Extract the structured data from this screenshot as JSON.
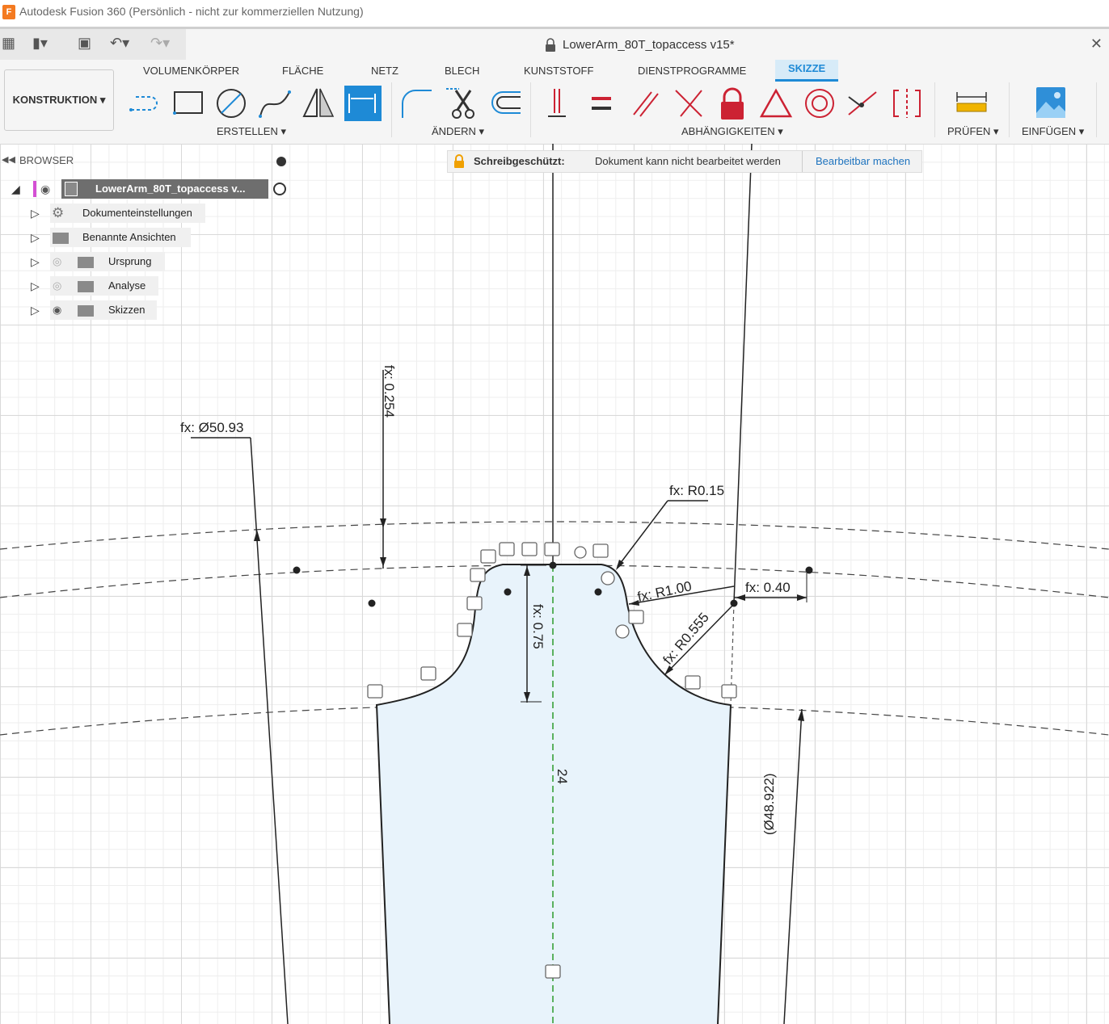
{
  "window": {
    "title": "Autodesk Fusion 360 (Persönlich - nicht zur kommerziellen Nutzung)",
    "app_icon": "F"
  },
  "document": {
    "title": "LowerArm_80T_topaccess v15*"
  },
  "workspace": {
    "label": "KONSTRUKTION ▾"
  },
  "ribbon_tabs": [
    "VOLUMENKÖRPER",
    "FLÄCHE",
    "NETZ",
    "BLECH",
    "KUNSTSTOFF",
    "DIENSTPROGRAMME",
    "SKIZZE"
  ],
  "ribbon_groups": {
    "create": "ERSTELLEN ▾",
    "modify": "ÄNDERN ▾",
    "constraints": "ABHÄNGIGKEITEN ▾",
    "inspect": "PRÜFEN ▾",
    "insert": "EINFÜGEN ▾"
  },
  "browser": {
    "header": "BROWSER",
    "root": "LowerArm_80T_topaccess v...",
    "items": [
      {
        "label": "Dokumenteinstellungen",
        "icon": "gear-icon"
      },
      {
        "label": "Benannte Ansichten",
        "icon": "folder-icon"
      },
      {
        "label": "Ursprung",
        "icon": "folder-icon",
        "visibility": "hidden"
      },
      {
        "label": "Analyse",
        "icon": "folder-icon",
        "visibility": "hidden"
      },
      {
        "label": "Skizzen",
        "icon": "folder-icon",
        "visibility": "visible"
      }
    ]
  },
  "banner": {
    "label": "Schreibgeschützt:",
    "message": "Dokument kann nicht bearbeitet werden",
    "action": "Bearbeitbar machen"
  },
  "dimensions": {
    "d1": "fx: Ø50.93",
    "d2": "fx: 0.254",
    "d3": "fx: R0.15",
    "d4": "fx: R1.00",
    "d5": "fx: 0.40",
    "d6": "fx: 0.75",
    "d7": "fx: R0.555",
    "d8": "24",
    "d9": "(Ø48.922)"
  },
  "colors": {
    "accent": "#1e8ad6",
    "profile_fill": "#e8f3fb",
    "construction_line": "#2a9a2a"
  }
}
